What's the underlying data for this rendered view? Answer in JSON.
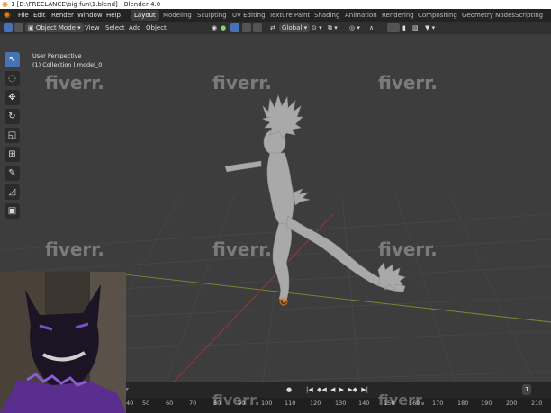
{
  "title_bar": {
    "title": "1 [D:\\FREELANCE\\big fun\\1.blend] - Blender 4.0"
  },
  "menu": [
    "File",
    "Edit",
    "Render",
    "Window",
    "Help"
  ],
  "workspaces": [
    "Layout",
    "Modeling",
    "Sculpting",
    "UV Editing",
    "Texture Paint",
    "Shading",
    "Animation",
    "Rendering",
    "Compositing",
    "Geometry Nodes",
    "Scripting"
  ],
  "active_workspace": "Layout",
  "header": {
    "mode": "Object Mode",
    "view": "View",
    "select": "Select",
    "add": "Add",
    "object": "Object",
    "orientation": "Global"
  },
  "viewport": {
    "perspective": "User Perspective",
    "collection": "(1) Collection | model_0"
  },
  "tools": [
    "select-box-icon",
    "cursor-icon",
    "move-icon",
    "rotate-icon",
    "scale-icon",
    "transform-icon",
    "annotate-icon",
    "measure-icon",
    "add-cube-icon"
  ],
  "timeline": {
    "current_frame": "1",
    "start_label": "r",
    "frames": [
      "40",
      "50",
      "60",
      "70",
      "80",
      "90",
      "100",
      "110",
      "120",
      "130",
      "140",
      "150",
      "160",
      "170",
      "180",
      "190",
      "200",
      "210"
    ]
  },
  "watermark": "fiverr.",
  "colors": {
    "accent": "#4772b3",
    "brand": "#e87d0d"
  }
}
